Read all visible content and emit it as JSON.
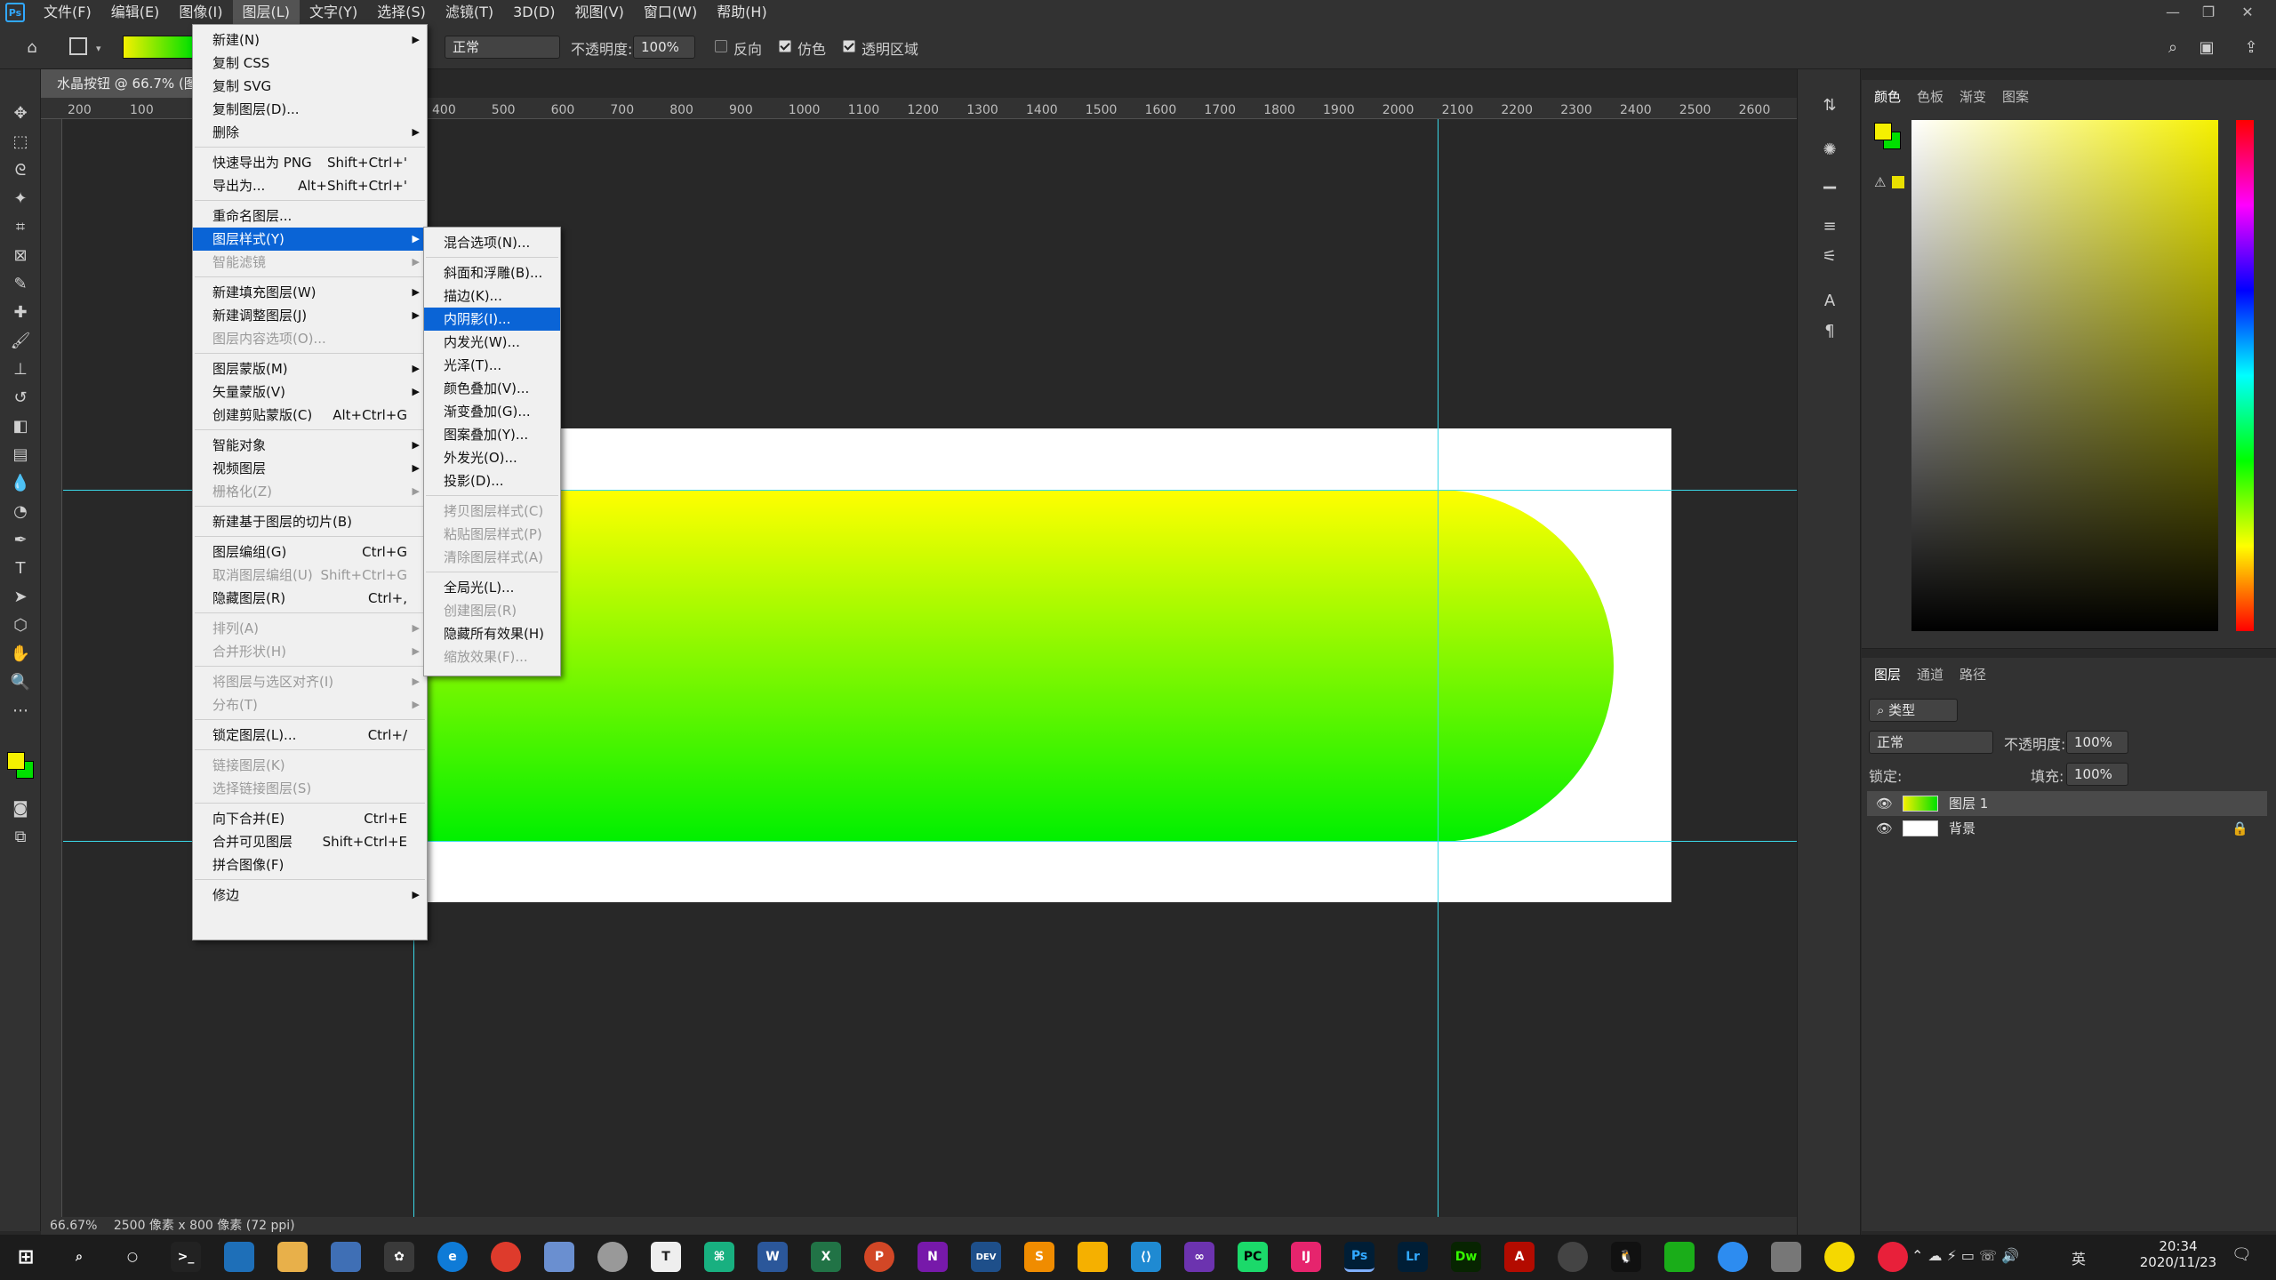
{
  "app": {
    "logo": "Ps"
  },
  "menubar": [
    "文件(F)",
    "编辑(E)",
    "图像(I)",
    "图层(L)",
    "文字(Y)",
    "选择(S)",
    "滤镜(T)",
    "3D(D)",
    "视图(V)",
    "窗口(W)",
    "帮助(H)"
  ],
  "optbar": {
    "mode_value": "正常",
    "opacity_label": "不透明度:",
    "opacity_value": "100%",
    "reverse_label": "反向",
    "dither_label": "仿色",
    "transparency_label": "透明区域"
  },
  "doc_tab": "水晶按钮 @ 66.7% (图层 1, RGB/8#)",
  "ruler_ticks": [
    "200",
    "100",
    "400",
    "500",
    "600",
    "700",
    "800",
    "900",
    "1000",
    "1100",
    "1200",
    "1300",
    "1400",
    "1500",
    "1600",
    "1700",
    "1800",
    "1900",
    "2000",
    "2100",
    "2200",
    "2300",
    "2400",
    "2500",
    "2600",
    "2"
  ],
  "status": {
    "zoom": "66.67%",
    "info": "2500 像素 x 800 像素 (72 ppi)"
  },
  "layer_menu": [
    {
      "label": "新建(N)",
      "arrow": true
    },
    {
      "label": "复制 CSS"
    },
    {
      "label": "复制 SVG"
    },
    {
      "label": "复制图层(D)..."
    },
    {
      "label": "删除",
      "arrow": true
    },
    {
      "sep": true
    },
    {
      "label": "快速导出为 PNG",
      "shortcut": "Shift+Ctrl+'"
    },
    {
      "label": "导出为...",
      "shortcut": "Alt+Shift+Ctrl+'"
    },
    {
      "sep": true
    },
    {
      "label": "重命名图层..."
    },
    {
      "label": "图层样式(Y)",
      "arrow": true,
      "highlight": true
    },
    {
      "label": "智能滤镜",
      "arrow": true,
      "disabled": true
    },
    {
      "sep": true
    },
    {
      "label": "新建填充图层(W)",
      "arrow": true
    },
    {
      "label": "新建调整图层(J)",
      "arrow": true
    },
    {
      "label": "图层内容选项(O)...",
      "disabled": true
    },
    {
      "sep": true
    },
    {
      "label": "图层蒙版(M)",
      "arrow": true
    },
    {
      "label": "矢量蒙版(V)",
      "arrow": true
    },
    {
      "label": "创建剪贴蒙版(C)",
      "shortcut": "Alt+Ctrl+G"
    },
    {
      "sep": true
    },
    {
      "label": "智能对象",
      "arrow": true
    },
    {
      "label": "视频图层",
      "arrow": true
    },
    {
      "label": "栅格化(Z)",
      "arrow": true,
      "disabled": true
    },
    {
      "sep": true
    },
    {
      "label": "新建基于图层的切片(B)"
    },
    {
      "sep": true
    },
    {
      "label": "图层编组(G)",
      "shortcut": "Ctrl+G"
    },
    {
      "label": "取消图层编组(U)",
      "shortcut": "Shift+Ctrl+G",
      "disabled": true
    },
    {
      "label": "隐藏图层(R)",
      "shortcut": "Ctrl+,"
    },
    {
      "sep": true
    },
    {
      "label": "排列(A)",
      "arrow": true,
      "disabled": true
    },
    {
      "label": "合并形状(H)",
      "arrow": true,
      "disabled": true
    },
    {
      "sep": true
    },
    {
      "label": "将图层与选区对齐(I)",
      "arrow": true,
      "disabled": true
    },
    {
      "label": "分布(T)",
      "arrow": true,
      "disabled": true
    },
    {
      "sep": true
    },
    {
      "label": "锁定图层(L)...",
      "shortcut": "Ctrl+/"
    },
    {
      "sep": true
    },
    {
      "label": "链接图层(K)",
      "disabled": true
    },
    {
      "label": "选择链接图层(S)",
      "disabled": true
    },
    {
      "sep": true
    },
    {
      "label": "向下合并(E)",
      "shortcut": "Ctrl+E"
    },
    {
      "label": "合并可见图层",
      "shortcut": "Shift+Ctrl+E"
    },
    {
      "label": "拼合图像(F)"
    },
    {
      "sep": true
    },
    {
      "label": "修边",
      "arrow": true
    }
  ],
  "style_menu": [
    {
      "label": "混合选项(N)..."
    },
    {
      "sep": true
    },
    {
      "label": "斜面和浮雕(B)..."
    },
    {
      "label": "描边(K)..."
    },
    {
      "label": "内阴影(I)...",
      "highlight": true
    },
    {
      "label": "内发光(W)..."
    },
    {
      "label": "光泽(T)..."
    },
    {
      "label": "颜色叠加(V)..."
    },
    {
      "label": "渐变叠加(G)..."
    },
    {
      "label": "图案叠加(Y)..."
    },
    {
      "label": "外发光(O)..."
    },
    {
      "label": "投影(D)..."
    },
    {
      "sep": true
    },
    {
      "label": "拷贝图层样式(C)",
      "disabled": true
    },
    {
      "label": "粘贴图层样式(P)",
      "disabled": true
    },
    {
      "label": "清除图层样式(A)",
      "disabled": true
    },
    {
      "sep": true
    },
    {
      "label": "全局光(L)..."
    },
    {
      "label": "创建图层(R)",
      "disabled": true
    },
    {
      "label": "隐藏所有效果(H)"
    },
    {
      "label": "缩放效果(F)...",
      "disabled": true
    }
  ],
  "color_panel": {
    "tabs": [
      "颜色",
      "色板",
      "渐变",
      "图案"
    ],
    "fg": "#f5f000",
    "bg": "#00e000"
  },
  "layers_panel": {
    "tabs": [
      "图层",
      "通道",
      "路径"
    ],
    "filter": "类型",
    "blend": "正常",
    "opacity_label": "不透明度:",
    "opacity": "100%",
    "lock_label": "锁定:",
    "fill_label": "填充:",
    "fill": "100%",
    "layers": [
      {
        "name": "图层 1"
      },
      {
        "name": "背景"
      }
    ]
  },
  "taskbar": {
    "time": "20:34",
    "date": "2020/11/23",
    "ime": "英"
  }
}
